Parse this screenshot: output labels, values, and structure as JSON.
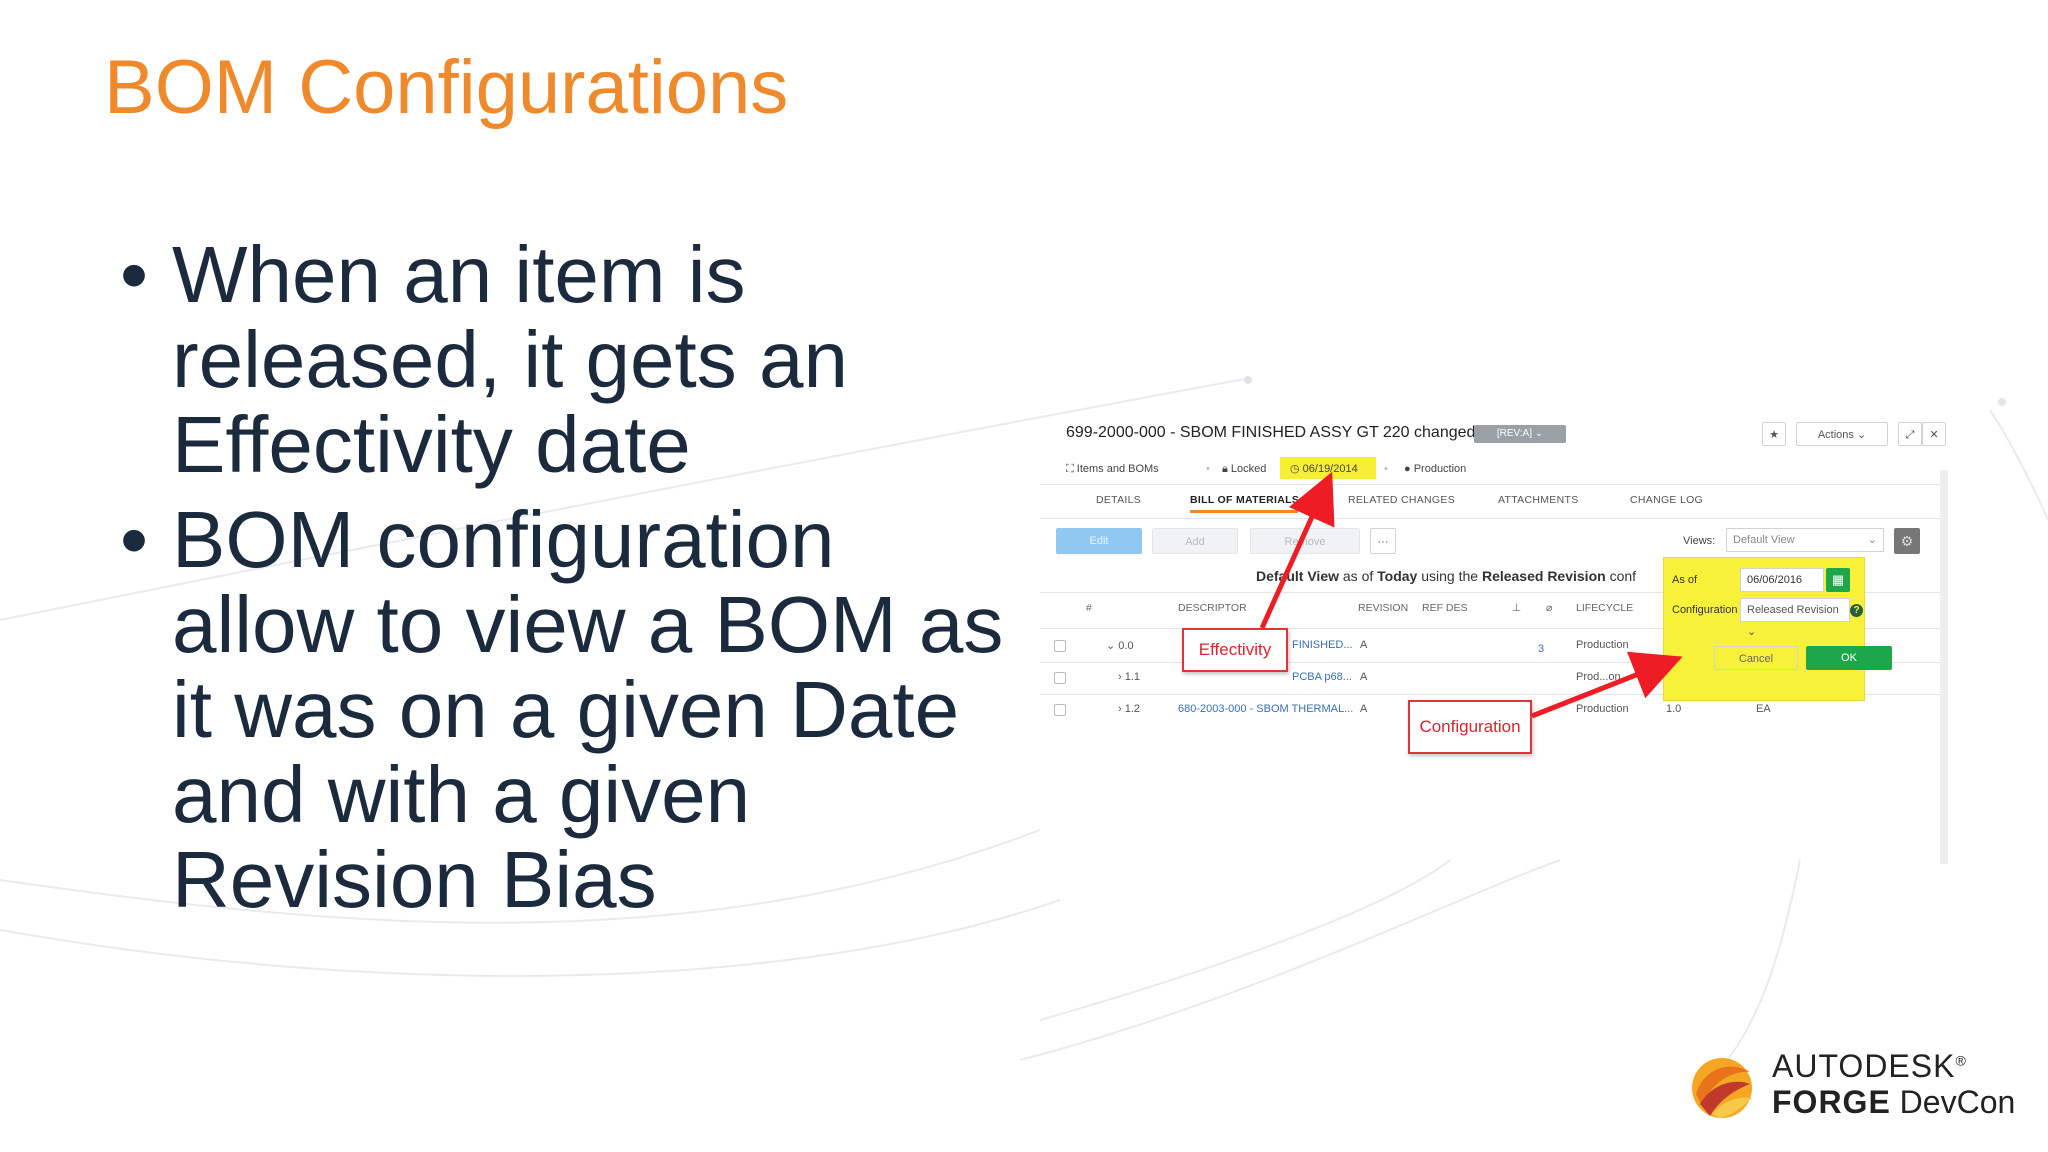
{
  "slide": {
    "title": "BOM Configurations",
    "bullet_symbol": "•",
    "bullets": [
      {
        "lines": [
          "When an item is",
          "released, it gets an",
          "Effectivity date"
        ]
      },
      {
        "lines": [
          "BOM configuration",
          "allow to view a BOM as",
          "it was on a given Date",
          "and with a given",
          "Revision Bias"
        ]
      }
    ]
  },
  "screenshot": {
    "item_title": "699-2000-000 - SBOM FINISHED ASSY GT 220 changed",
    "revision_badge": "[REV:A] ⌄",
    "actions_label": "Actions ⌄",
    "status": {
      "workspace": "Items and BOMs",
      "lock": "Locked",
      "effectivity": "06/19/2014",
      "lifecycle": "Production"
    },
    "tabs": [
      "DETAILS",
      "BILL OF MATERIALS",
      "RELATED CHANGES",
      "ATTACHMENTS",
      "CHANGE LOG"
    ],
    "active_tab": "BILL OF MATERIALS",
    "buttons": {
      "edit": "Edit",
      "add": "Add",
      "remove": "Remove",
      "more": "···"
    },
    "views": {
      "label": "Views:",
      "selected": "Default View"
    },
    "view_description": {
      "part1": "Default View",
      "part2": " as of ",
      "part3": "Today",
      "part4": " using the ",
      "part5": "Released Revision",
      "part6": " conf"
    },
    "columns": [
      "#",
      "DESCRIPTOR",
      "REVISION",
      "REF DES",
      "LIFECYCLE"
    ],
    "rows": [
      {
        "num": "⌄ 0.0",
        "descriptor": "FINISHED...",
        "revision": "A",
        "attachments": "3",
        "lifecycle": "Production"
      },
      {
        "num": "› 1.1",
        "descriptor": "PCBA p68...",
        "revision": "A",
        "lifecycle": "Prod...on"
      },
      {
        "num": "› 1.2",
        "descriptor": "680-2003-000 - SBOM THERMAL...",
        "revision": "A",
        "lifecycle": "Production",
        "quantity": "1.0",
        "units": "EA"
      }
    ],
    "config_popup": {
      "as_of_label": "As of",
      "as_of_value": "06/06/2016",
      "configuration_label": "Configuration",
      "configuration_value": "Released Revision ⌄",
      "cancel": "Cancel",
      "ok": "OK"
    },
    "callouts": {
      "effectivity": "Effectivity",
      "configuration": "Configuration"
    }
  },
  "logo": {
    "line1": "AUTODESK",
    "reg": "®",
    "line2_bold": "FORGE",
    "line2_rest": " DevCon"
  },
  "colors": {
    "title": "#ef8a2c",
    "text": "#1b2a3d",
    "highlight": "#f8f139",
    "ok_button": "#1ea64a",
    "callout_red": "#e0343b",
    "accent_orange": "#f08a24"
  }
}
